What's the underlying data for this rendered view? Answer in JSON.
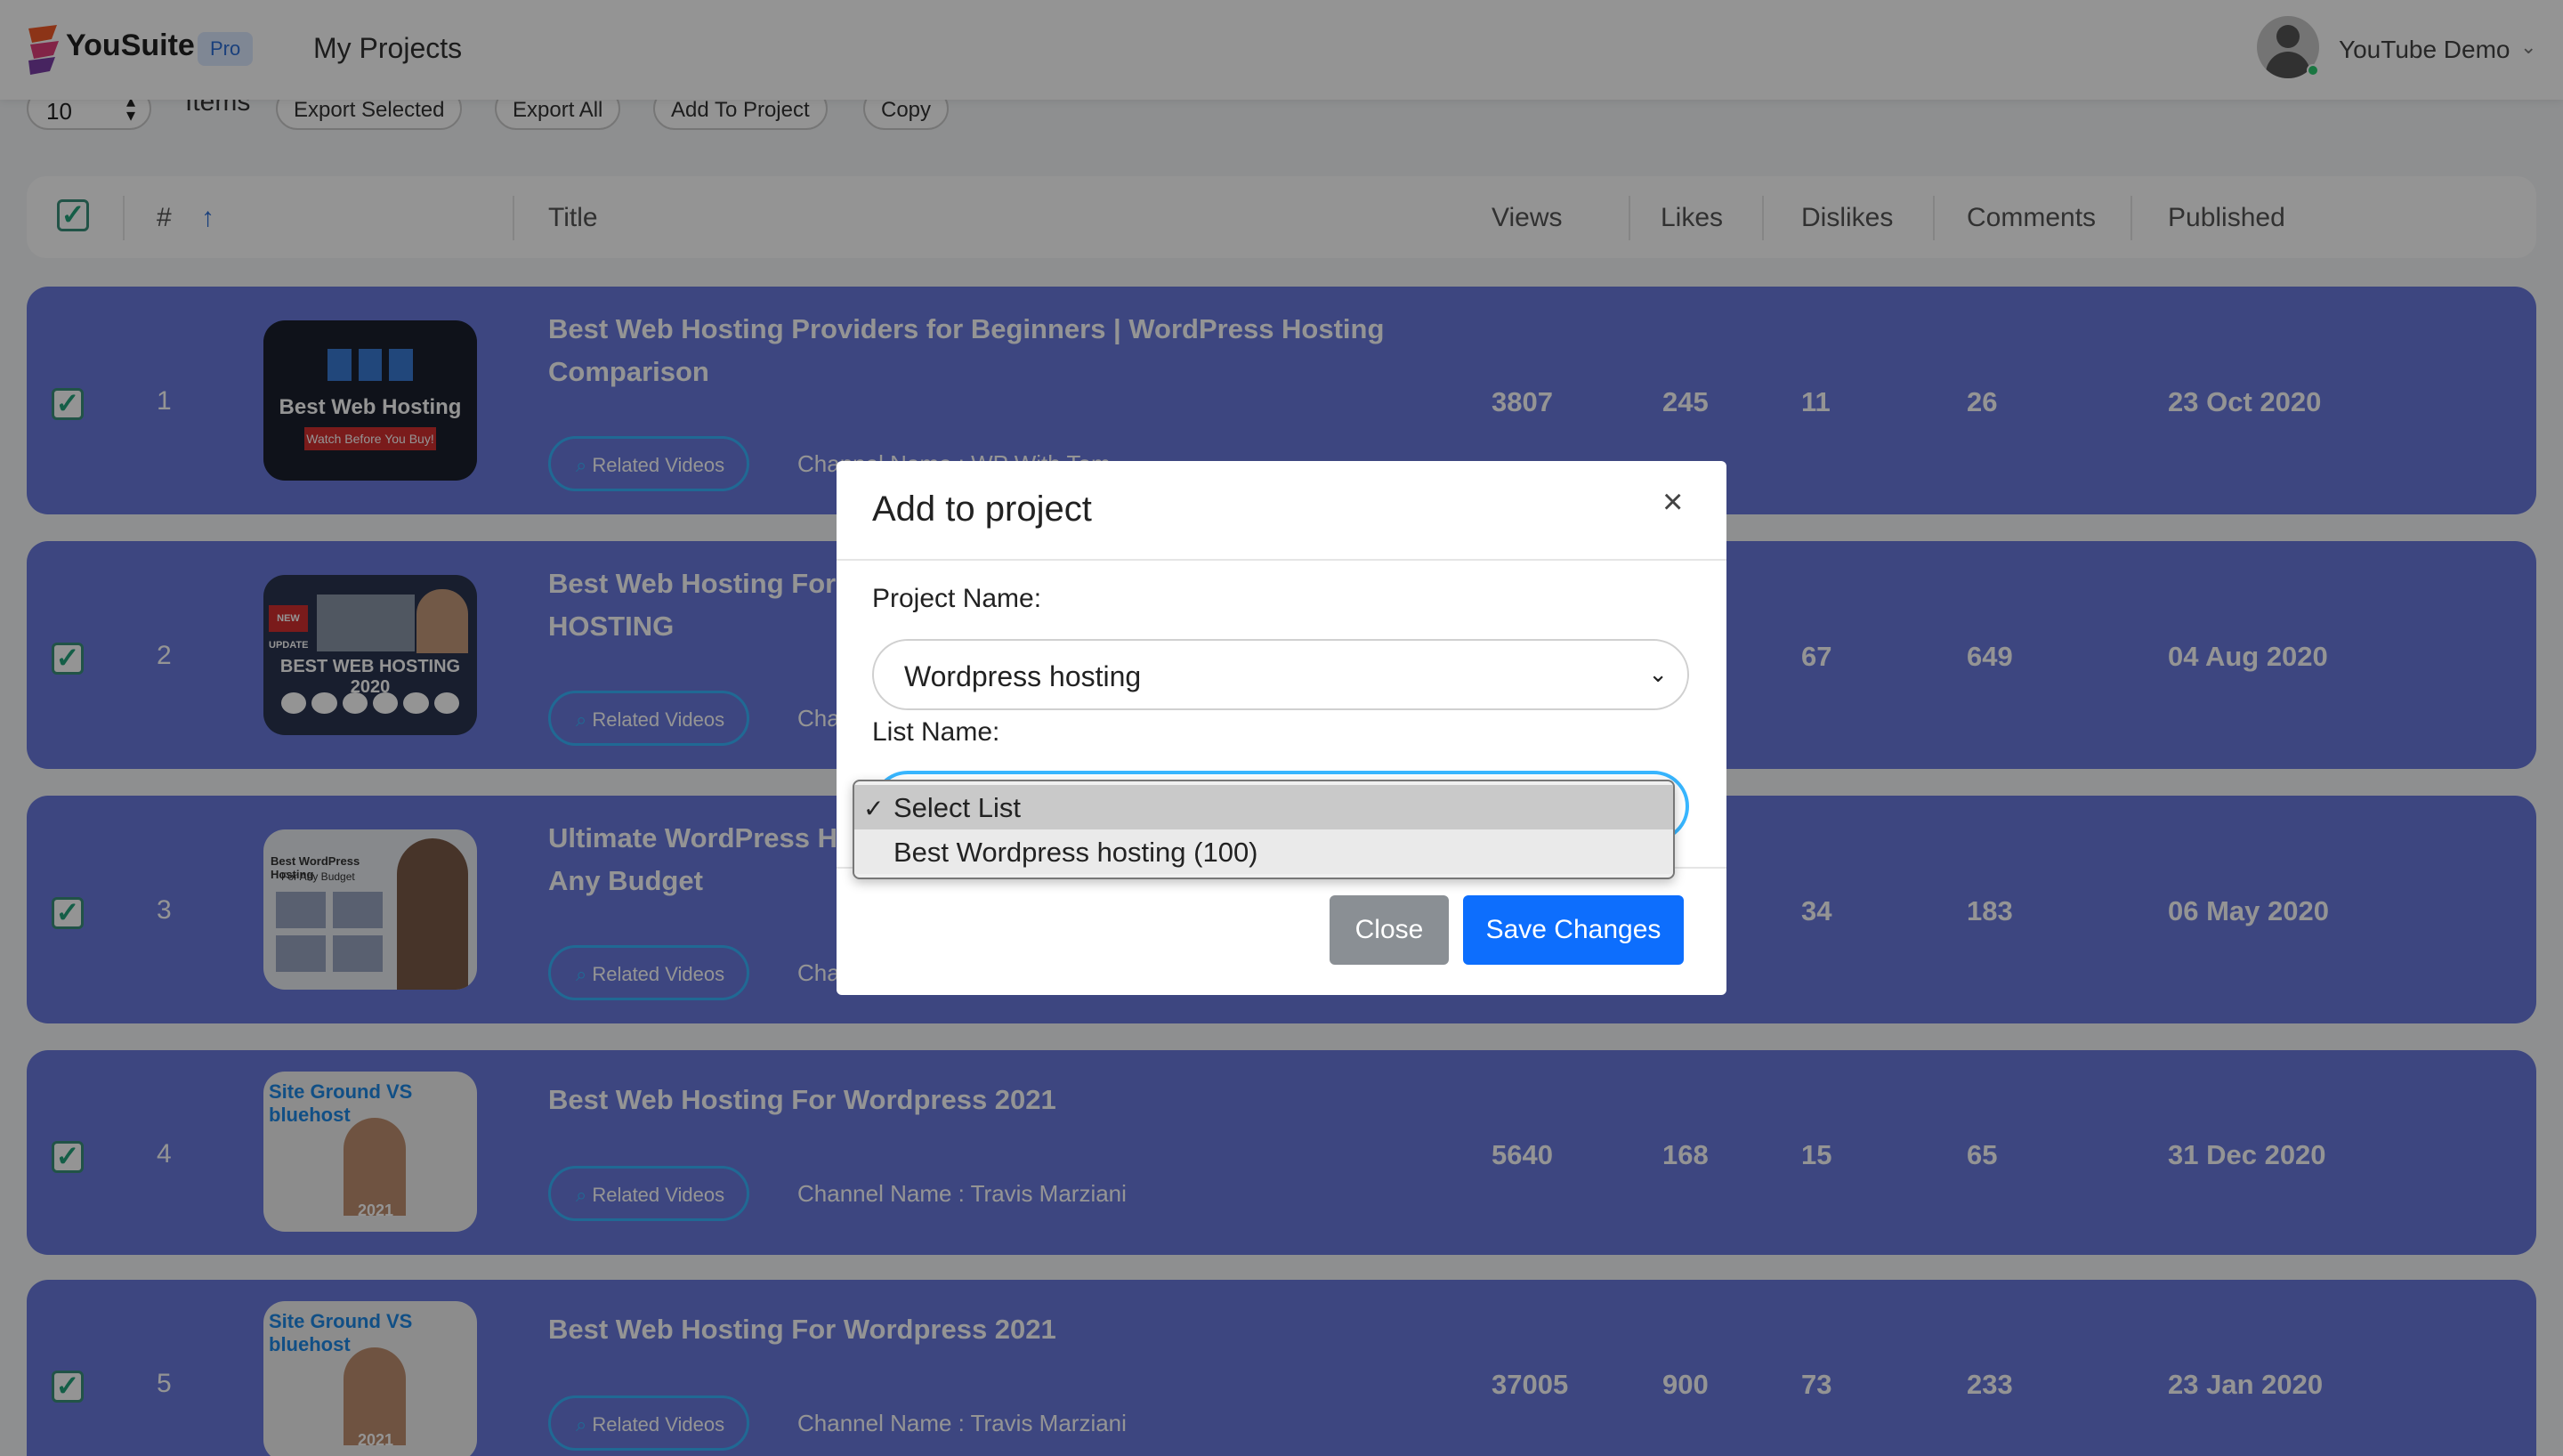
{
  "header": {
    "brand": "YouSuite",
    "badge": "Pro",
    "nav_item": "My Projects",
    "user_name": "YouTube Demo"
  },
  "toolbar": {
    "items_per_page": "10",
    "items_label": "Items",
    "buttons": [
      "Export Selected",
      "Export All",
      "Add To Project",
      "Copy"
    ]
  },
  "table": {
    "headers": {
      "num": "#",
      "title": "Title",
      "views": "Views",
      "likes": "Likes",
      "dislikes": "Dislikes",
      "comments": "Comments",
      "published": "Published"
    },
    "related_label": "Related Videos",
    "rows": [
      {
        "num": "1",
        "title": "Best Web Hosting Providers for Beginners | WordPress Hosting Comparison",
        "channel": "Channel Name : WP With Tom",
        "views": "3807",
        "likes": "245",
        "dislikes": "11",
        "comments": "26",
        "published": "23 Oct 2020",
        "thumb_text": "Best Web Hosting",
        "thumb_sub": "Watch Before You Buy!"
      },
      {
        "num": "2",
        "title": "Best Web Hosting For WordPress 2020 | BEST WORDPRESS HOSTING",
        "channel": "Channel Name",
        "views": "",
        "likes": "",
        "dislikes": "67",
        "comments": "649",
        "published": "04 Aug 2020",
        "thumb_text": "BEST WEB HOSTING 2020",
        "thumb_sub": "NEW UPDATE"
      },
      {
        "num": "3",
        "title": "Ultimate WordPress Hosting Guide | Best WordPress Host for Any Budget",
        "channel": "Channel Name",
        "views": "",
        "likes": "",
        "dislikes": "34",
        "comments": "183",
        "published": "06 May 2020",
        "thumb_text": "Best WordPress Hosting",
        "thumb_sub": "For Any Budget"
      },
      {
        "num": "4",
        "title": "Best Web Hosting For Wordpress 2021",
        "channel": "Channel Name : Travis Marziani",
        "views": "5640",
        "likes": "168",
        "dislikes": "15",
        "comments": "65",
        "published": "31 Dec 2020",
        "thumb_text": "Site Ground VS bluehost",
        "thumb_sub": "2021"
      },
      {
        "num": "5",
        "title": "Best Web Hosting For Wordpress 2021",
        "channel": "Channel Name : Travis Marziani",
        "views": "37005",
        "likes": "900",
        "dislikes": "73",
        "comments": "233",
        "published": "23 Jan 2020",
        "thumb_text": "Site Ground VS bluehost",
        "thumb_sub": "2021"
      }
    ]
  },
  "modal": {
    "title": "Add to project",
    "close_x": "×",
    "project_label": "Project Name:",
    "project_value": "Wordpress hosting",
    "list_label": "List Name:",
    "list_options": [
      "Select List",
      "Best Wordpress hosting (100)"
    ],
    "close_button": "Close",
    "save_button": "Save Changes"
  },
  "colors": {
    "row_bg": "#6979dd",
    "accent_blue": "#0d6efd",
    "related_border": "#38b6ff",
    "check_green": "#23a37a"
  }
}
